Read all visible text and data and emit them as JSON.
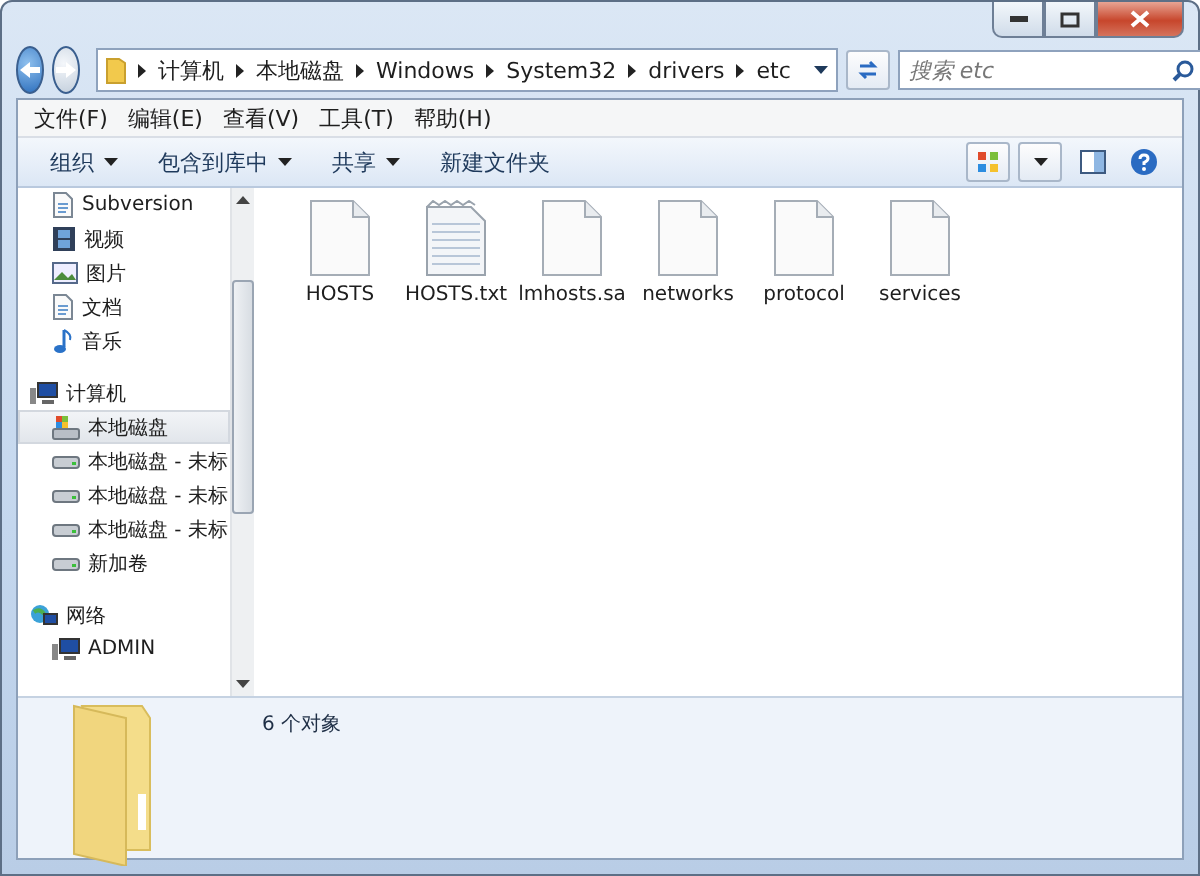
{
  "address": {
    "crumbs": [
      "计算机",
      "本地磁盘",
      "Windows",
      "System32",
      "drivers",
      "etc"
    ]
  },
  "search": {
    "placeholder": "搜索 etc"
  },
  "menu": [
    "文件(F)",
    "编辑(E)",
    "查看(V)",
    "工具(T)",
    "帮助(H)"
  ],
  "toolbar": [
    {
      "label": "组织",
      "dropdown": true
    },
    {
      "label": "包含到库中",
      "dropdown": true
    },
    {
      "label": "共享",
      "dropdown": true
    },
    {
      "label": "新建文件夹",
      "dropdown": false
    }
  ],
  "nav": [
    {
      "children": [
        {
          "label": "Subversion",
          "kind": "doc",
          "selected": false
        },
        {
          "label": "视频",
          "kind": "video",
          "selected": false
        },
        {
          "label": "图片",
          "kind": "picture",
          "selected": false
        },
        {
          "label": "文档",
          "kind": "doc",
          "selected": false
        },
        {
          "label": "音乐",
          "kind": "music",
          "selected": false
        }
      ]
    },
    {
      "label": "计算机",
      "kind": "computer",
      "children": [
        {
          "label": "本地磁盘",
          "kind": "system-drive",
          "selected": true
        },
        {
          "label": "本地磁盘 - 未标",
          "kind": "drive",
          "selected": false
        },
        {
          "label": "本地磁盘 - 未标",
          "kind": "drive",
          "selected": false
        },
        {
          "label": "本地磁盘 - 未标",
          "kind": "drive",
          "selected": false
        },
        {
          "label": "新加卷",
          "kind": "drive",
          "selected": false
        }
      ]
    },
    {
      "label": "网络",
      "kind": "network",
      "children": [
        {
          "label": "ADMIN",
          "kind": "computer",
          "selected": false
        }
      ]
    }
  ],
  "files": [
    {
      "name": "HOSTS",
      "kind": "blank"
    },
    {
      "name": "HOSTS.txt",
      "kind": "text"
    },
    {
      "name": "lmhosts.sa",
      "kind": "blank"
    },
    {
      "name": "networks",
      "kind": "blank"
    },
    {
      "name": "protocol",
      "kind": "blank"
    },
    {
      "name": "services",
      "kind": "blank"
    }
  ],
  "details": {
    "count": "6 个对象"
  }
}
